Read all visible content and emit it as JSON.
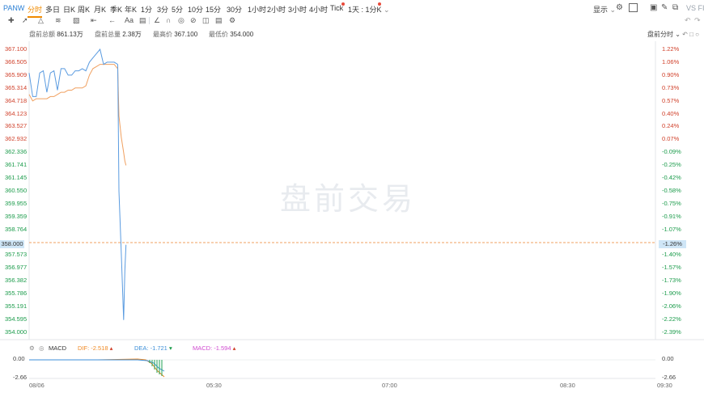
{
  "symbol": "PANW",
  "periods": [
    "分时",
    "多日",
    "日K",
    "周K",
    "月K",
    "季K",
    "年K",
    "1分",
    "3分",
    "5分",
    "10分",
    "15分",
    "30分",
    "1小时",
    "2小时",
    "3小时",
    "4小时",
    "Tick"
  ],
  "active_period": "分时",
  "range_selector": "1天 : 1分K",
  "top_right": {
    "display_label": "显示",
    "vs_label": "VS FII"
  },
  "toolbar_tools": [
    "crosshair",
    "line",
    "channel",
    "fib",
    "measure",
    "arrow",
    "text",
    "brush",
    "magnet",
    "lock",
    "hide",
    "trash",
    "settings"
  ],
  "toolbar_text_tool": "Aa",
  "info": {
    "premarket_amount_label": "盘前总额",
    "premarket_amount": "861.13万",
    "premarket_volume_label": "盘前总量",
    "premarket_volume": "2.38万",
    "high_label": "最高价",
    "high": "367.100",
    "low_label": "最低价",
    "low": "354.000",
    "mode": "盘前分时"
  },
  "watermark": "盘前交易",
  "price_ticks": [
    "367.100",
    "366.505",
    "365.909",
    "365.314",
    "364.718",
    "364.123",
    "363.527",
    "362.932",
    "362.336",
    "361.741",
    "361.145",
    "360.550",
    "359.955",
    "359.359",
    "358.764",
    "357.573",
    "356.977",
    "356.382",
    "355.786",
    "355.191",
    "354.595",
    "354.000"
  ],
  "pct_ticks": [
    "1.22%",
    "1.06%",
    "0.90%",
    "0.73%",
    "0.57%",
    "0.40%",
    "0.24%",
    "0.07%",
    "-0.09%",
    "-0.25%",
    "-0.42%",
    "-0.58%",
    "-0.75%",
    "-0.91%",
    "-1.07%",
    "-1.40%",
    "-1.57%",
    "-1.73%",
    "-1.90%",
    "-2.06%",
    "-2.22%",
    "-2.39%"
  ],
  "current": {
    "price": "358.000",
    "pct": "-1.26%"
  },
  "macd": {
    "label": "MACD",
    "dif_label": "DIF: -2.518",
    "dea_label": "DEA: -1.721",
    "macd_label": "MACD: -1.594",
    "left_ticks": [
      "0.00",
      "-2.66"
    ],
    "right_ticks": [
      "0.00",
      "-2.66"
    ],
    "colors": {
      "dif": "#f08a24",
      "dea": "#3d8fd8",
      "macd": "#d04ad0",
      "hist_down": "#22a354"
    }
  },
  "x_ticks": [
    "08/06",
    "05:30",
    "07:00",
    "08:30",
    "09:30"
  ],
  "colors": {
    "price_line": "#5a9be0",
    "avg_line": "#f0a060",
    "up": "#d0402a",
    "down": "#1a9b4a",
    "accent": "#f08a00"
  },
  "chart_data": {
    "type": "line",
    "title": "",
    "xlabel": "",
    "ylabel": "",
    "ylim": [
      354.0,
      367.1
    ],
    "x": [
      "04:00",
      "04:03",
      "04:06",
      "04:09",
      "04:12",
      "04:15",
      "04:18",
      "04:21",
      "04:24",
      "04:27",
      "04:30",
      "04:33",
      "04:36",
      "04:39",
      "04:42",
      "04:45",
      "04:48",
      "04:51",
      "04:54",
      "04:57",
      "05:00",
      "05:03",
      "05:06",
      "05:09",
      "05:12",
      "05:15"
    ],
    "series": [
      {
        "values": [
          366.0,
          364.9,
          364.9,
          366.0,
          366.1,
          365.1,
          366.0,
          366.1,
          365.2,
          366.2,
          366.2,
          365.9,
          365.9,
          366.1,
          366.1,
          366.2,
          366.1,
          366.5,
          366.7,
          366.9,
          367.1,
          366.4,
          366.5,
          366.5,
          366.5,
          366.4
        ]
      },
      {
        "values": [
          365.0,
          364.7,
          364.8,
          364.8,
          364.8,
          364.8,
          364.9,
          364.9,
          365.0,
          365.1,
          365.1,
          365.2,
          365.2,
          365.3,
          365.3,
          365.3,
          365.4,
          365.9,
          366.2,
          366.3,
          366.4,
          366.4,
          366.4,
          366.4,
          366.4,
          366.2
        ]
      }
    ],
    "x_after_drop": [
      "05:15",
      "05:16",
      "05:18",
      "05:20",
      "05:21",
      "05:22"
    ],
    "price_after_drop": [
      366.4,
      360.5,
      357.6,
      354.5,
      356.8,
      358.0
    ],
    "avg_after_drop": [
      366.2,
      364.0,
      363.0,
      362.3,
      361.9,
      361.7
    ]
  }
}
